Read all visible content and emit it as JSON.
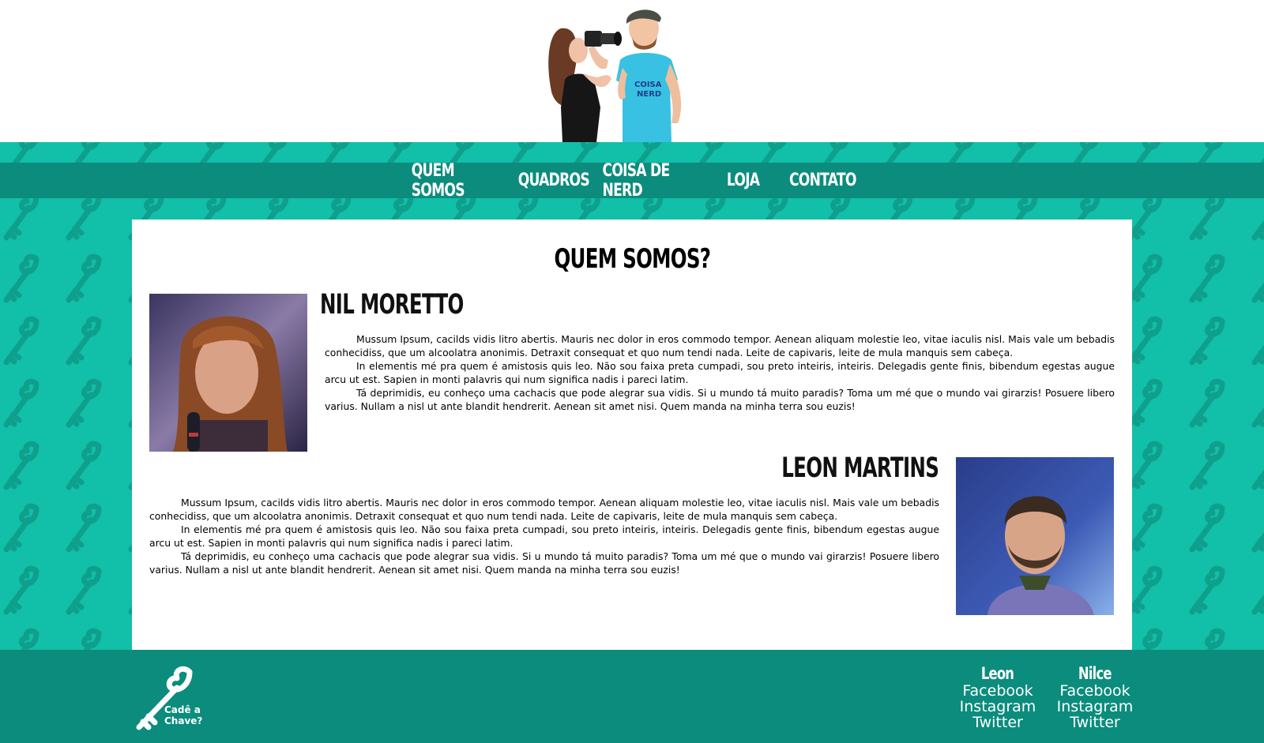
{
  "colors": {
    "teal": "#12bfa8",
    "dark_teal": "#0b8c7d",
    "white": "#ffffff"
  },
  "header": {
    "illustration": "two-cartoon-people-camera-illustration",
    "shirt_logo_text": "COISA DE NERD"
  },
  "nav": {
    "items": [
      {
        "label": "QUEM SOMOS"
      },
      {
        "label": "QUADROS"
      },
      {
        "label": "COISA DE NERD"
      },
      {
        "label": "LOJA"
      },
      {
        "label": "CONTATO"
      }
    ]
  },
  "main": {
    "title": "QUEM SOMOS?",
    "people": [
      {
        "name": "NIL MORETTO",
        "photo": "woman-with-microphone-photo",
        "paragraphs": [
          "Mussum Ipsum, cacilds vidis litro abertis. Mauris nec dolor in eros commodo tempor. Aenean aliquam molestie leo, vitae iaculis nisl. Mais vale um bebadis conhecidiss, que um alcoolatra anonimis. Detraxit consequat et quo num tendi nada. Leite de capivaris, leite de mula manquis sem cabeça.",
          "In elementis mé pra quem é amistosis quis leo. Não sou faixa preta cumpadi, sou preto inteiris, inteiris. Delegadis gente finis, bibendum egestas augue arcu ut est. Sapien in monti palavris qui num significa nadis i pareci latim.",
          "Tá deprimidis, eu conheço uma cachacis que pode alegrar sua vidis. Si u mundo tá muito paradis? Toma um mé que o mundo vai girarzis! Posuere libero varius. Nullam a nisl ut ante blandit hendrerit. Aenean sit amet nisi. Quem manda na minha terra sou euzis!"
        ]
      },
      {
        "name": "LEON MARTINS",
        "photo": "bearded-man-photo",
        "paragraphs": [
          "Mussum Ipsum, cacilds vidis litro abertis. Mauris nec dolor in eros commodo tempor. Aenean aliquam molestie leo, vitae iaculis nisl. Mais vale um bebadis conhecidiss, que um alcoolatra anonimis. Detraxit consequat et quo num tendi nada. Leite de capivaris, leite de mula manquis sem cabeça.",
          "In elementis mé pra quem é amistosis quis leo. Não sou faixa preta cumpadi, sou preto inteiris, inteiris. Delegadis gente finis, bibendum egestas augue arcu ut est. Sapien in monti palavris qui num significa nadis i pareci latim.",
          "Tá deprimidis, eu conheço uma cachacis que pode alegrar sua vidis. Si u mundo tá muito paradis? Toma um mé que o mundo vai girarzis! Posuere libero varius. Nullam a nisl ut ante blandit hendrerit. Aenean sit amet nisi. Quem manda na minha terra sou euzis!"
        ]
      }
    ]
  },
  "footer": {
    "logo_icon": "key-icon",
    "logo_text_line1": "Cadê a",
    "logo_text_line2": "Chave?",
    "socials": [
      {
        "name": "Leon",
        "links": [
          "Facebook",
          "Instagram",
          "Twitter"
        ]
      },
      {
        "name": "Nilce",
        "links": [
          "Facebook",
          "Instagram",
          "Twitter"
        ]
      }
    ]
  }
}
